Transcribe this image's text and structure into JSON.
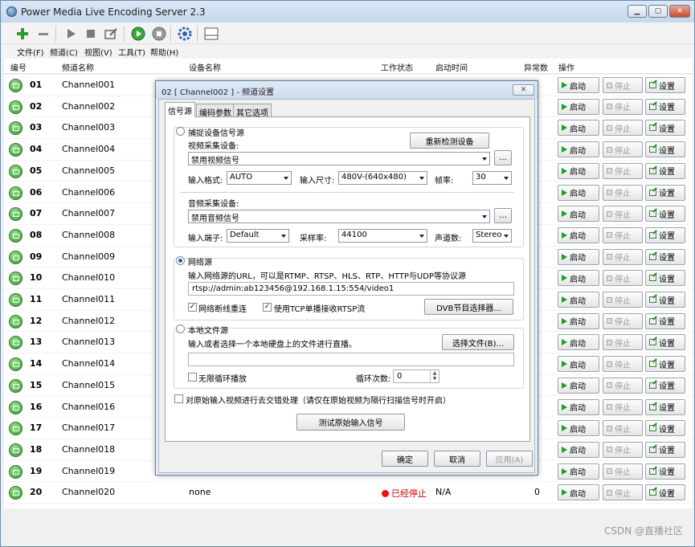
{
  "app": {
    "title": "Power Media Live Encoding Server 2.3",
    "window_buttons": {
      "minimize": "▁",
      "maximize": "▢",
      "close": "✕"
    }
  },
  "toolbar": {
    "icons": [
      "add-icon",
      "remove-icon",
      "play-icon",
      "stop-icon",
      "edit-icon",
      "start-all-icon",
      "stop-all-icon",
      "gear-icon",
      "layout-icon"
    ]
  },
  "menu": [
    "文件(F)",
    "频道(C)",
    "视图(V)",
    "工具(T)",
    "帮助(H)"
  ],
  "list": {
    "columns": {
      "id": "编号",
      "name": "频道名称",
      "device": "设备名称",
      "status": "工作状态",
      "start_time": "启动时间",
      "errors": "异常数",
      "actions": "操作"
    },
    "button_labels": {
      "start": "启动",
      "stop": "停止",
      "settings": "设置"
    },
    "rows": [
      {
        "id": "01",
        "name": "Channel001"
      },
      {
        "id": "02",
        "name": "Channel002"
      },
      {
        "id": "03",
        "name": "Channel003"
      },
      {
        "id": "04",
        "name": "Channel004"
      },
      {
        "id": "05",
        "name": "Channel005"
      },
      {
        "id": "06",
        "name": "Channel006"
      },
      {
        "id": "07",
        "name": "Channel007"
      },
      {
        "id": "08",
        "name": "Channel008"
      },
      {
        "id": "09",
        "name": "Channel009"
      },
      {
        "id": "10",
        "name": "Channel010"
      },
      {
        "id": "11",
        "name": "Channel011"
      },
      {
        "id": "12",
        "name": "Channel012"
      },
      {
        "id": "13",
        "name": "Channel013"
      },
      {
        "id": "14",
        "name": "Channel014"
      },
      {
        "id": "15",
        "name": "Channel015"
      },
      {
        "id": "16",
        "name": "Channel016"
      },
      {
        "id": "17",
        "name": "Channel017"
      },
      {
        "id": "18",
        "name": "Channel018"
      },
      {
        "id": "19",
        "name": "Channel019"
      },
      {
        "id": "20",
        "name": "Channel020",
        "device": "none",
        "status": "已经停止",
        "start_time": "N/A",
        "errors": "0"
      }
    ]
  },
  "dialog": {
    "title": "02 [ Channel002 ] - 频道设置",
    "close": "✕",
    "tabs": [
      "信号源",
      "编码参数",
      "其它选项"
    ],
    "capture": {
      "label": "捕捉设备信号源",
      "video_device_label": "视频采集设备:",
      "redetect_button": "重新检测设备",
      "video_device_value": "禁用视频信号",
      "browse": "...",
      "input_format_label": "输入格式:",
      "input_format_value": "AUTO",
      "input_size_label": "输入尺寸:",
      "input_size_value": "480V-(640x480)",
      "framerate_label": "帧率:",
      "framerate_value": "30",
      "audio_device_label": "音频采集设备:",
      "audio_device_value": "禁用音频信号",
      "input_port_label": "输入端子:",
      "input_port_value": "Default",
      "sample_rate_label": "采样率:",
      "sample_rate_value": "44100",
      "channels_label": "声道数:",
      "channels_value": "Stereo"
    },
    "network": {
      "label": "网络源",
      "hint": "输入网络源的URL，可以是RTMP、RTSP、HLS、RTP、HTTP与UDP等协议源",
      "url": "rtsp://admin:ab123456@192.168.1.15:554/video1",
      "reconnect_label": "网络断线重连",
      "reconnect_checked": true,
      "tcp_label": "使用TCP单播接收RTSP流",
      "tcp_checked": true,
      "dvb_button": "DVB节目选择器...",
      "selected": true
    },
    "local_file": {
      "label": "本地文件源",
      "hint": "输入或者选择一个本地硬盘上的文件进行直播。",
      "choose_button": "选择文件(B)...",
      "path": "",
      "loop_label": "无限循环播放",
      "loop_checked": false,
      "loop_count_label": "循环次数:",
      "loop_count_value": "0"
    },
    "deinterlace_label": "对原始输入视频进行去交错处理（请仅在原始视频为隔行扫描信号时开启）",
    "test_button": "测试原始输入信号",
    "ok": "确定",
    "cancel": "取消",
    "apply": "应用(A)"
  },
  "watermark": "CSDN @直播社区"
}
